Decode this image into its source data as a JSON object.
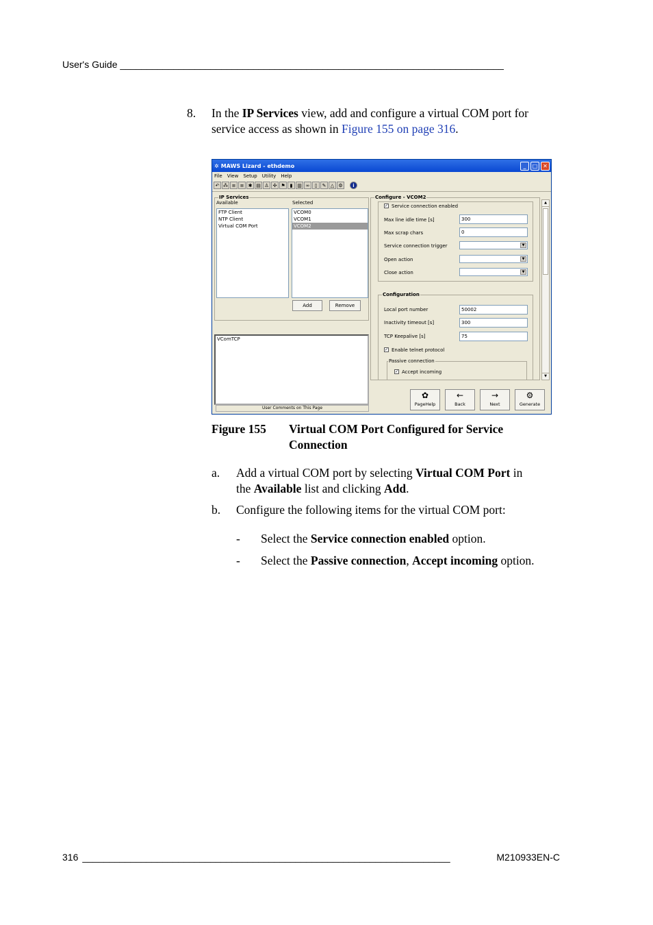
{
  "header": {
    "text": "User's Guide ________________________________________________________________________"
  },
  "step": {
    "number": "8.",
    "pre1": "In the ",
    "bold1": "IP Services",
    "post1": " view, add and configure a virtual COM port for",
    "line2_pre": "service access as shown in ",
    "link": "Figure 155 on page 316",
    "line2_post": "."
  },
  "app": {
    "title": "MAWS Lizard - ethdemo",
    "menu": [
      "File",
      "View",
      "Setup",
      "Utility",
      "Help"
    ],
    "ip_services": {
      "title": "IP Services",
      "available_label": "Available",
      "selected_label": "Selected",
      "available": [
        "FTP Client",
        "NTP Client",
        "Virtual COM Port"
      ],
      "selected": [
        "VCOM0",
        "VCOM1",
        "VCOM2"
      ],
      "selected_highlight": "VCOM2",
      "add": "Add",
      "remove": "Remove",
      "comment_text": "VComTCP",
      "comment_caption": "User Comments on This Page"
    },
    "configure": {
      "title": "Configure - VCOM2",
      "service_enabled": "Service connection enabled",
      "max_idle_label": "Max line idle time [s]",
      "max_idle": "300",
      "max_scrap_label": "Max scrap chars",
      "max_scrap": "0",
      "trigger_label": "Service connection trigger",
      "open_label": "Open action",
      "close_label": "Close action"
    },
    "configuration": {
      "title": "Configuration",
      "local_port_label": "Local port number",
      "local_port": "50002",
      "inactivity_label": "Inactivity timeout [s]",
      "inactivity": "300",
      "keepalive_label": "TCP Keepalive [s]",
      "keepalive": "75",
      "telnet": "Enable telnet protocol",
      "passive_title": "Passive connection",
      "accept": "Accept incoming"
    },
    "nav": {
      "pagehelp": "PageHelp",
      "back": "Back",
      "next": "Next",
      "generate": "Generate"
    }
  },
  "figure": {
    "label": "Figure 155",
    "caption_line1": "Virtual COM Port Configured for Service",
    "caption_line2": "Connection"
  },
  "items": {
    "a_marker": "a.",
    "a1_pre": "Add a virtual COM port by selecting ",
    "a1_b1": "Virtual COM Port",
    "a1_post": " in",
    "a2_pre": "the ",
    "a2_b1": "Available",
    "a2_mid": " list and clicking ",
    "a2_b2": "Add",
    "a2_post": ".",
    "b_marker": "b.",
    "b_text": "Configure the following items for the virtual COM port:",
    "d1_marker": "-",
    "d1_pre": "Select the ",
    "d1_b": "Service connection enabled",
    "d1_post": " option.",
    "d2_marker": "-",
    "d2_pre": "Select the ",
    "d2_b1": "Passive connection",
    "d2_sep": ", ",
    "d2_b2": "Accept incoming",
    "d2_post": " option."
  },
  "footer": {
    "page": "316",
    "line": "_____________________________________________________________________",
    "doc": "M210933EN-C"
  }
}
